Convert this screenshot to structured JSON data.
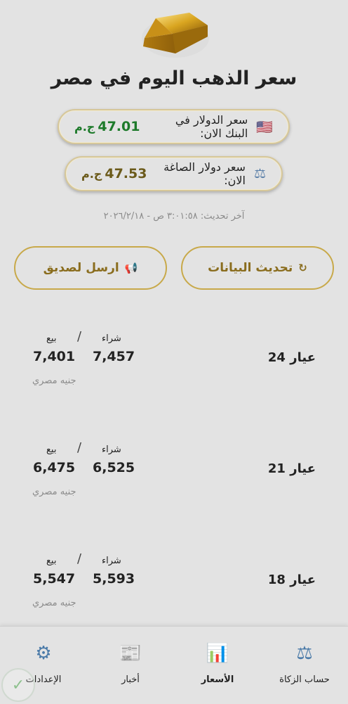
{
  "header": {
    "title": "سعر الذهب اليوم في مصر"
  },
  "bank_dollar": {
    "label": "سعر الدولار في البنك الان:",
    "value": "47.01",
    "currency": "ج.م",
    "flag": "🇺🇸",
    "color": "#1d7a2a"
  },
  "gold_dollar": {
    "label": "سعر دولار الصاغة الان:",
    "value": "47.53",
    "currency": "ج.م",
    "icon": "⚖",
    "color": "#6b5a1a"
  },
  "last_update": "آخر تحديث: ٣:٠١:٥٨ ص - ٢٠٢٦/٢/١٨",
  "actions": {
    "refresh_label": "تحديث البيانات",
    "refresh_icon": "↻",
    "share_label": "ارسل لصديق",
    "share_icon": "📢"
  },
  "prices": {
    "buy_label": "شراء",
    "sell_label": "بيع",
    "separator": "/",
    "unit": "جنيه مصري",
    "rows": [
      {
        "karat": "عيار 24",
        "buy": "7,457",
        "sell": "7,401"
      },
      {
        "karat": "عيار 21",
        "buy": "6,525",
        "sell": "6,475"
      },
      {
        "karat": "عيار 18",
        "buy": "5,593",
        "sell": "5,547"
      }
    ]
  },
  "nav": {
    "items": [
      {
        "label": "حساب الزكاة",
        "icon": "⚖"
      },
      {
        "label": "الأسعار",
        "icon": "📊"
      },
      {
        "label": "أخبار",
        "icon": "📰"
      },
      {
        "label": "الإعدادات",
        "icon": "⚙"
      }
    ],
    "active": "الأسعار"
  },
  "colors": {
    "background": "#e3e3e3",
    "accent_gold": "#c8a94a",
    "button_text": "#8a6d1e"
  }
}
